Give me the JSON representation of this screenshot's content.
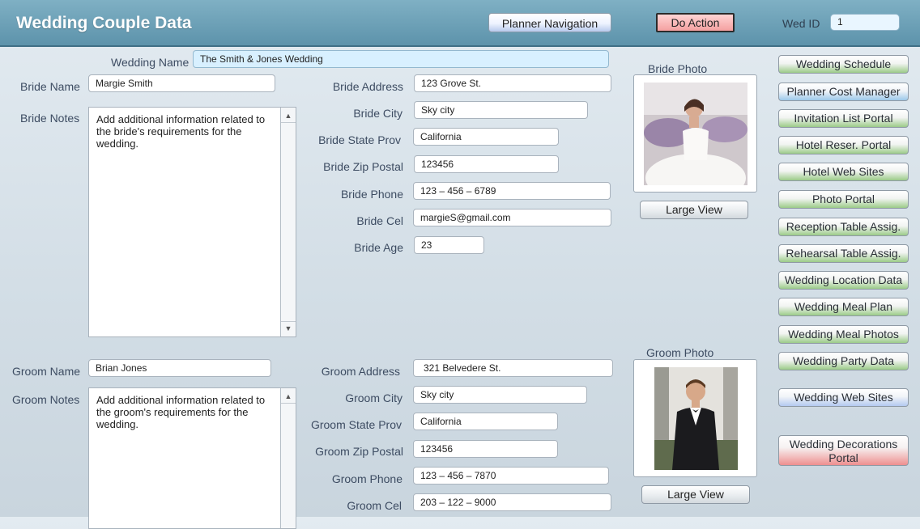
{
  "header": {
    "title": "Wedding Couple Data",
    "planner_nav_label": "Planner Navigation",
    "do_action_label": "Do Action",
    "wed_id_label": "Wed ID",
    "wed_id_value": "1"
  },
  "wedding": {
    "name_label": "Wedding Name",
    "name_value": "The Smith & Jones Wedding"
  },
  "bride": {
    "name_label": "Bride Name",
    "name_value": "Margie Smith",
    "notes_label": "Bride Notes",
    "notes_value": "Add additional information related to the bride's requirements for the wedding.",
    "address_label": "Bride Address",
    "address_value": "123 Grove St.",
    "city_label": "Bride City",
    "city_value": "Sky city",
    "state_label": "Bride State  Prov",
    "state_value": "California",
    "zip_label": "Bride Zip Postal",
    "zip_value": "123456",
    "phone_label": "Bride Phone",
    "phone_value": "123 – 456 – 6789",
    "cel_label": "Bride Cel",
    "cel_value": "margieS@gmail.com",
    "age_label": "Bride Age",
    "age_value": "23",
    "photo_label": "Bride Photo",
    "large_view_label": "Large View"
  },
  "groom": {
    "name_label": "Groom Name",
    "name_value": "Brian Jones",
    "notes_label": "Groom Notes",
    "notes_value": "Add additional information related to the groom's requirements for the wedding.",
    "address_label": "Groom Address",
    "address_value": "321 Belvedere St.",
    "city_label": "Groom City",
    "city_value": "Sky city",
    "state_label": "Groom State  Prov",
    "state_value": "California",
    "zip_label": "Groom Zip  Postal",
    "zip_value": "123456",
    "phone_label": "Groom Phone",
    "phone_value": "123 – 456 – 7870",
    "cel_label": "Groom Cel",
    "cel_value": "203 – 122 – 9000",
    "photo_label": "Groom Photo",
    "large_view_label": "Large View"
  },
  "sidebar": {
    "items": [
      {
        "label": "Wedding Schedule",
        "color": "green"
      },
      {
        "label": "Planner Cost Manager",
        "color": "blue"
      },
      {
        "label": "Invitation List Portal",
        "color": "green"
      },
      {
        "label": "Hotel Reser. Portal",
        "color": "green"
      },
      {
        "label": "Hotel Web Sites",
        "color": "green"
      },
      {
        "label": "Photo Portal",
        "color": "green"
      },
      {
        "label": "Reception Table Assig.",
        "color": "green"
      },
      {
        "label": "Rehearsal Table Assig.",
        "color": "green"
      },
      {
        "label": "Wedding Location Data",
        "color": "green"
      },
      {
        "label": "Wedding Meal Plan",
        "color": "green"
      },
      {
        "label": "Wedding Meal Photos",
        "color": "green"
      },
      {
        "label": "Wedding Party Data",
        "color": "green"
      },
      {
        "label": "Wedding Web Sites",
        "color": "light-blue"
      },
      {
        "label": "Wedding Decorations Portal",
        "color": "red"
      }
    ]
  }
}
